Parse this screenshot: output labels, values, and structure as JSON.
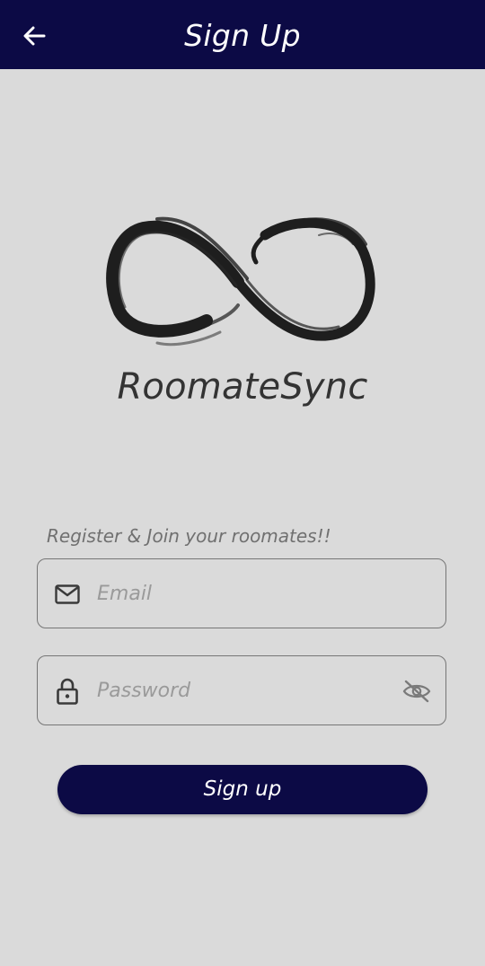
{
  "app_bar": {
    "title": "Sign Up",
    "back_icon": "arrow-left-icon",
    "background": "#0c0a45"
  },
  "branding": {
    "logo_icon": "infinity-brush-logo",
    "name": "RoomateSync"
  },
  "form": {
    "subtitle": "Register & Join your roomates!!",
    "email": {
      "icon": "mail-icon",
      "placeholder": "Email",
      "value": ""
    },
    "password": {
      "icon": "lock-icon",
      "placeholder": "Password",
      "value": "",
      "visibility_icon": "eye-off-icon"
    },
    "submit_label": "Sign up"
  },
  "colors": {
    "primary": "#0c0a45",
    "background": "#dadada",
    "border": "#767676"
  }
}
